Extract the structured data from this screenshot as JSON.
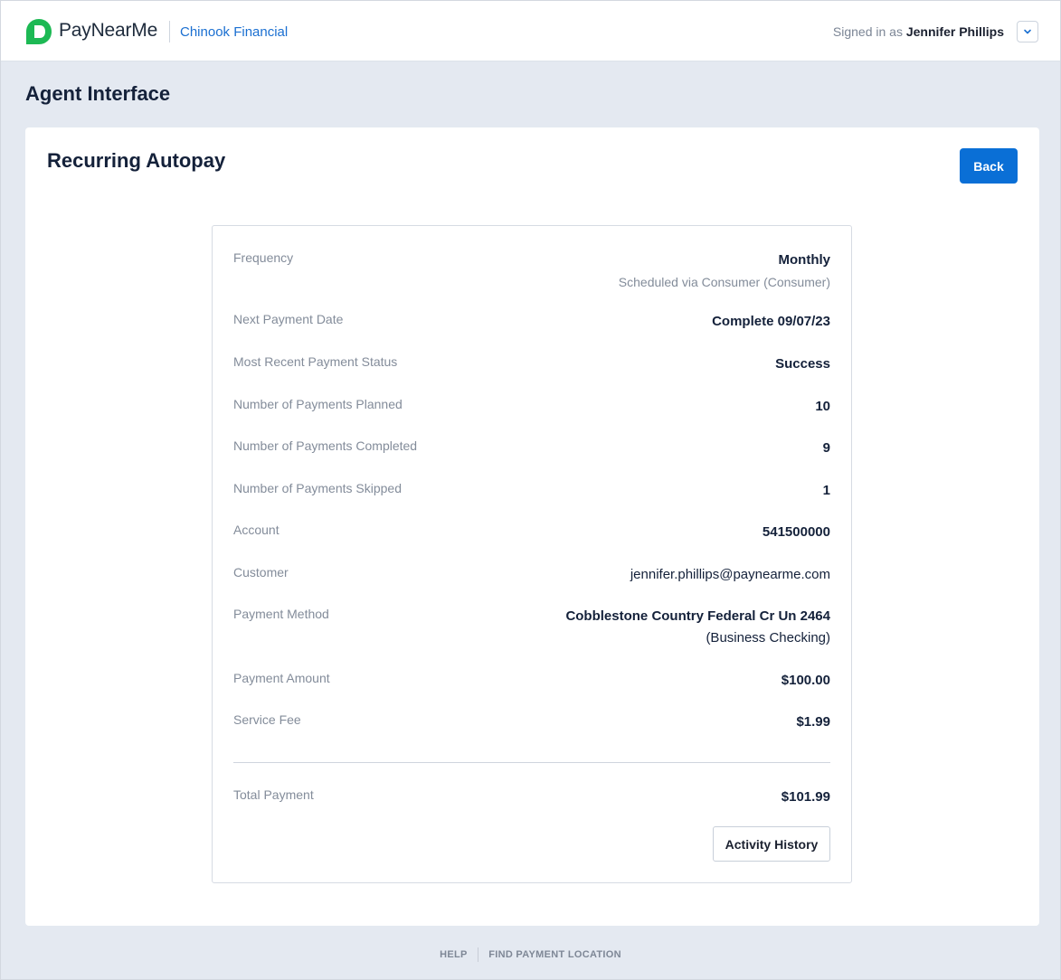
{
  "header": {
    "brand": "PayNearMe",
    "organization": "Chinook Financial",
    "signed_in_prefix": "Signed in as",
    "user_name": "Jennifer Phillips",
    "colors": {
      "brand_green": "#1db954",
      "link_blue": "#1a6fd1"
    }
  },
  "page": {
    "title": "Agent Interface"
  },
  "card": {
    "title": "Recurring Autopay",
    "back_label": "Back"
  },
  "details": {
    "frequency": {
      "label": "Frequency",
      "value": "Monthly",
      "sub": "Scheduled via Consumer (Consumer)"
    },
    "next_payment": {
      "label": "Next Payment Date",
      "value": "Complete 09/07/23"
    },
    "recent_status": {
      "label": "Most Recent Payment Status",
      "value": "Success"
    },
    "planned": {
      "label": "Number of Payments Planned",
      "value": "10"
    },
    "completed": {
      "label": "Number of Payments Completed",
      "value": "9"
    },
    "skipped": {
      "label": "Number of Payments Skipped",
      "value": "1"
    },
    "account": {
      "label": "Account",
      "value": "541500000"
    },
    "customer": {
      "label": "Customer",
      "value": "jennifer.phillips@paynearme.com"
    },
    "payment_method": {
      "label": "Payment Method",
      "value": "Cobblestone Country Federal Cr Un 2464",
      "sub": "(Business Checking)"
    },
    "amount": {
      "label": "Payment Amount",
      "value": "$100.00"
    },
    "fee": {
      "label": "Service Fee",
      "value": "$1.99"
    },
    "total": {
      "label": "Total Payment",
      "value": "$101.99"
    },
    "activity_label": "Activity History"
  },
  "footer": {
    "help": "HELP",
    "find_location": "FIND PAYMENT LOCATION"
  }
}
